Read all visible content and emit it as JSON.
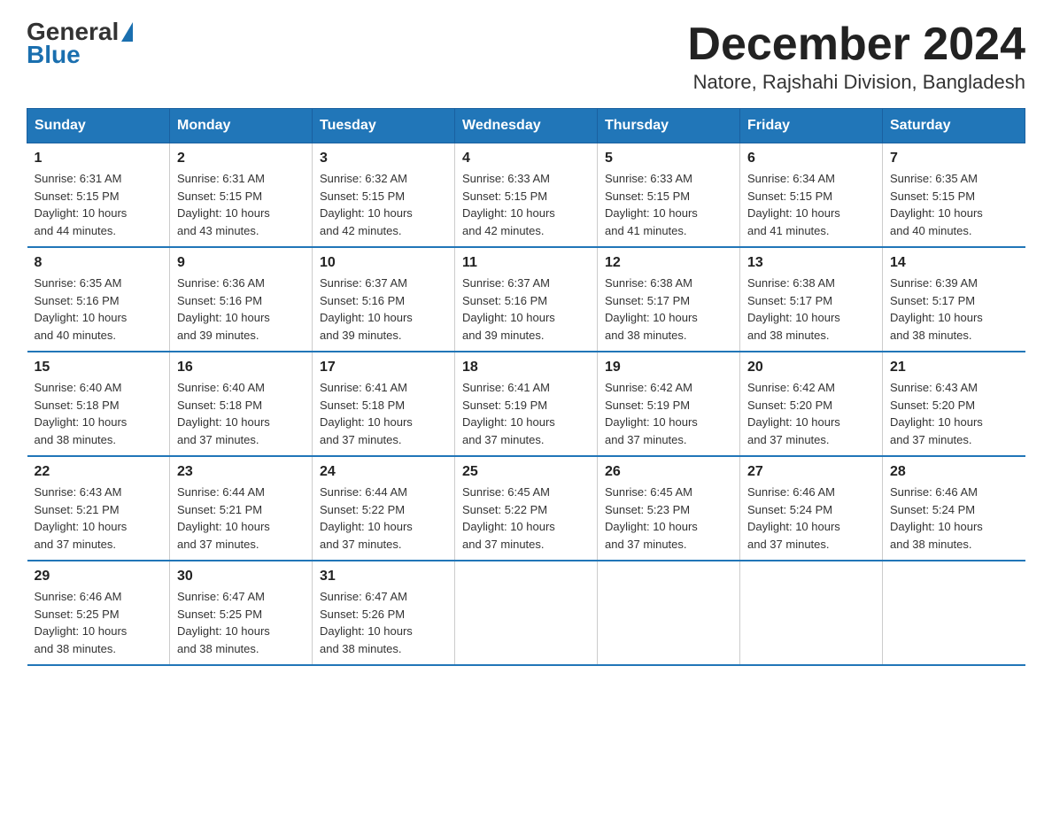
{
  "header": {
    "logo": {
      "general": "General",
      "blue": "Blue"
    },
    "title": "December 2024",
    "location": "Natore, Rajshahi Division, Bangladesh"
  },
  "days_of_week": [
    "Sunday",
    "Monday",
    "Tuesday",
    "Wednesday",
    "Thursday",
    "Friday",
    "Saturday"
  ],
  "weeks": [
    [
      {
        "day": "1",
        "sunrise": "6:31 AM",
        "sunset": "5:15 PM",
        "daylight": "10 hours and 44 minutes."
      },
      {
        "day": "2",
        "sunrise": "6:31 AM",
        "sunset": "5:15 PM",
        "daylight": "10 hours and 43 minutes."
      },
      {
        "day": "3",
        "sunrise": "6:32 AM",
        "sunset": "5:15 PM",
        "daylight": "10 hours and 42 minutes."
      },
      {
        "day": "4",
        "sunrise": "6:33 AM",
        "sunset": "5:15 PM",
        "daylight": "10 hours and 42 minutes."
      },
      {
        "day": "5",
        "sunrise": "6:33 AM",
        "sunset": "5:15 PM",
        "daylight": "10 hours and 41 minutes."
      },
      {
        "day": "6",
        "sunrise": "6:34 AM",
        "sunset": "5:15 PM",
        "daylight": "10 hours and 41 minutes."
      },
      {
        "day": "7",
        "sunrise": "6:35 AM",
        "sunset": "5:15 PM",
        "daylight": "10 hours and 40 minutes."
      }
    ],
    [
      {
        "day": "8",
        "sunrise": "6:35 AM",
        "sunset": "5:16 PM",
        "daylight": "10 hours and 40 minutes."
      },
      {
        "day": "9",
        "sunrise": "6:36 AM",
        "sunset": "5:16 PM",
        "daylight": "10 hours and 39 minutes."
      },
      {
        "day": "10",
        "sunrise": "6:37 AM",
        "sunset": "5:16 PM",
        "daylight": "10 hours and 39 minutes."
      },
      {
        "day": "11",
        "sunrise": "6:37 AM",
        "sunset": "5:16 PM",
        "daylight": "10 hours and 39 minutes."
      },
      {
        "day": "12",
        "sunrise": "6:38 AM",
        "sunset": "5:17 PM",
        "daylight": "10 hours and 38 minutes."
      },
      {
        "day": "13",
        "sunrise": "6:38 AM",
        "sunset": "5:17 PM",
        "daylight": "10 hours and 38 minutes."
      },
      {
        "day": "14",
        "sunrise": "6:39 AM",
        "sunset": "5:17 PM",
        "daylight": "10 hours and 38 minutes."
      }
    ],
    [
      {
        "day": "15",
        "sunrise": "6:40 AM",
        "sunset": "5:18 PM",
        "daylight": "10 hours and 38 minutes."
      },
      {
        "day": "16",
        "sunrise": "6:40 AM",
        "sunset": "5:18 PM",
        "daylight": "10 hours and 37 minutes."
      },
      {
        "day": "17",
        "sunrise": "6:41 AM",
        "sunset": "5:18 PM",
        "daylight": "10 hours and 37 minutes."
      },
      {
        "day": "18",
        "sunrise": "6:41 AM",
        "sunset": "5:19 PM",
        "daylight": "10 hours and 37 minutes."
      },
      {
        "day": "19",
        "sunrise": "6:42 AM",
        "sunset": "5:19 PM",
        "daylight": "10 hours and 37 minutes."
      },
      {
        "day": "20",
        "sunrise": "6:42 AM",
        "sunset": "5:20 PM",
        "daylight": "10 hours and 37 minutes."
      },
      {
        "day": "21",
        "sunrise": "6:43 AM",
        "sunset": "5:20 PM",
        "daylight": "10 hours and 37 minutes."
      }
    ],
    [
      {
        "day": "22",
        "sunrise": "6:43 AM",
        "sunset": "5:21 PM",
        "daylight": "10 hours and 37 minutes."
      },
      {
        "day": "23",
        "sunrise": "6:44 AM",
        "sunset": "5:21 PM",
        "daylight": "10 hours and 37 minutes."
      },
      {
        "day": "24",
        "sunrise": "6:44 AM",
        "sunset": "5:22 PM",
        "daylight": "10 hours and 37 minutes."
      },
      {
        "day": "25",
        "sunrise": "6:45 AM",
        "sunset": "5:22 PM",
        "daylight": "10 hours and 37 minutes."
      },
      {
        "day": "26",
        "sunrise": "6:45 AM",
        "sunset": "5:23 PM",
        "daylight": "10 hours and 37 minutes."
      },
      {
        "day": "27",
        "sunrise": "6:46 AM",
        "sunset": "5:24 PM",
        "daylight": "10 hours and 37 minutes."
      },
      {
        "day": "28",
        "sunrise": "6:46 AM",
        "sunset": "5:24 PM",
        "daylight": "10 hours and 38 minutes."
      }
    ],
    [
      {
        "day": "29",
        "sunrise": "6:46 AM",
        "sunset": "5:25 PM",
        "daylight": "10 hours and 38 minutes."
      },
      {
        "day": "30",
        "sunrise": "6:47 AM",
        "sunset": "5:25 PM",
        "daylight": "10 hours and 38 minutes."
      },
      {
        "day": "31",
        "sunrise": "6:47 AM",
        "sunset": "5:26 PM",
        "daylight": "10 hours and 38 minutes."
      },
      null,
      null,
      null,
      null
    ]
  ],
  "labels": {
    "sunrise": "Sunrise:",
    "sunset": "Sunset:",
    "daylight": "Daylight:"
  }
}
